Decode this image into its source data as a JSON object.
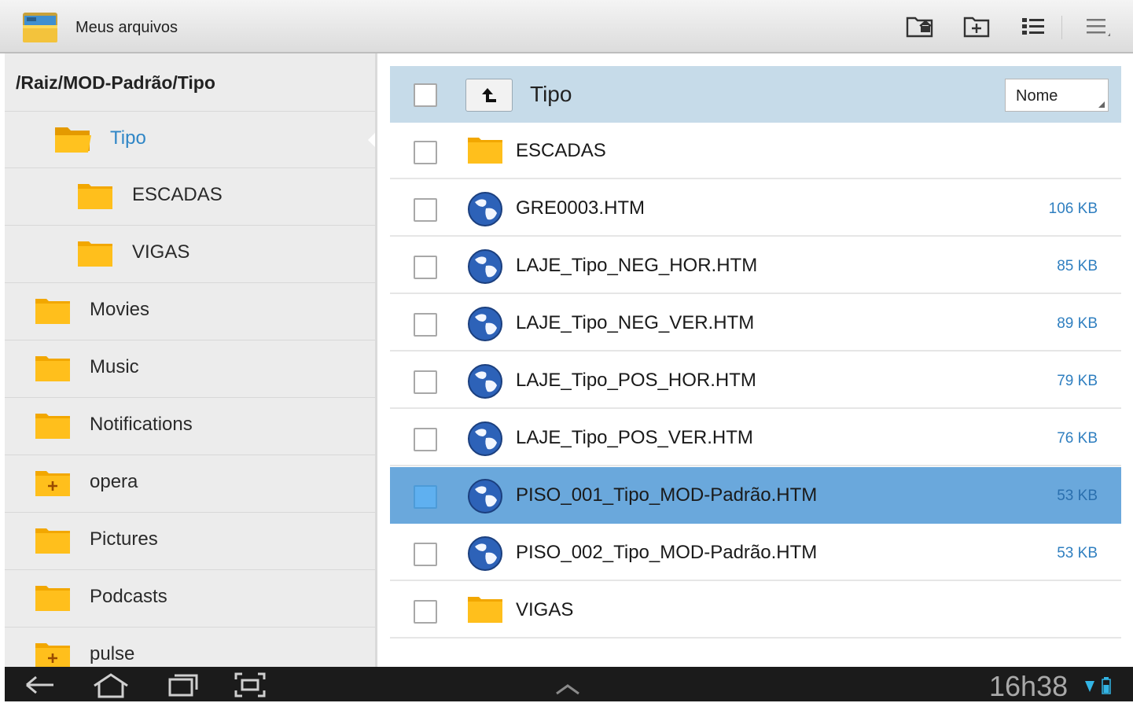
{
  "app": {
    "title": "Meus arquivos"
  },
  "actionbar": {
    "icons": [
      "folder-home-icon",
      "new-folder-icon",
      "list-view-icon",
      "menu-icon"
    ]
  },
  "sidebar": {
    "path": "/Raiz/MOD-Padrão/Tipo",
    "items": [
      {
        "label": "Tipo",
        "icon": "folder-open-icon",
        "selected": true
      },
      {
        "label": "ESCADAS",
        "icon": "folder-icon"
      },
      {
        "label": "VIGAS",
        "icon": "folder-icon"
      },
      {
        "label": "Movies",
        "icon": "folder-icon"
      },
      {
        "label": "Music",
        "icon": "folder-icon"
      },
      {
        "label": "Notifications",
        "icon": "folder-icon"
      },
      {
        "label": "opera",
        "icon": "folder-plus-icon"
      },
      {
        "label": "Pictures",
        "icon": "folder-icon"
      },
      {
        "label": "Podcasts",
        "icon": "folder-icon"
      },
      {
        "label": "pulse",
        "icon": "folder-plus-icon"
      }
    ]
  },
  "main": {
    "current_folder": "Tipo",
    "sort": {
      "selected": "Nome"
    },
    "files": [
      {
        "name": "ESCADAS",
        "size": "",
        "type": "folder"
      },
      {
        "name": "GRE0003.HTM",
        "size": "106 KB",
        "type": "html"
      },
      {
        "name": "LAJE_Tipo_NEG_HOR.HTM",
        "size": "85 KB",
        "type": "html"
      },
      {
        "name": "LAJE_Tipo_NEG_VER.HTM",
        "size": "89 KB",
        "type": "html"
      },
      {
        "name": "LAJE_Tipo_POS_HOR.HTM",
        "size": "79 KB",
        "type": "html"
      },
      {
        "name": "LAJE_Tipo_POS_VER.HTM",
        "size": "76 KB",
        "type": "html"
      },
      {
        "name": "PISO_001_Tipo_MOD-Padrão.HTM",
        "size": "53 KB",
        "type": "html",
        "selected": true
      },
      {
        "name": "PISO_002_Tipo_MOD-Padrão.HTM",
        "size": "53 KB",
        "type": "html"
      },
      {
        "name": "VIGAS",
        "size": "",
        "type": "folder"
      }
    ]
  },
  "system_bar": {
    "time": "16h38"
  },
  "colors": {
    "accent": "#2f86c6",
    "selection": "#6aa8dc",
    "header": "#c6dbe9",
    "folder": "#f6a800"
  }
}
